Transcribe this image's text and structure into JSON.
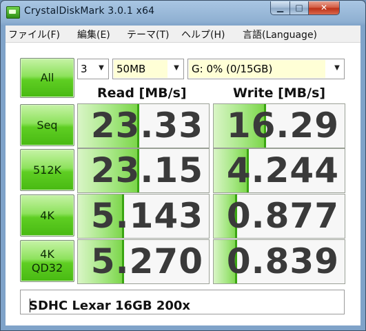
{
  "window": {
    "title": "CrystalDiskMark 3.0.1 x64"
  },
  "menu": [
    "ファイル(F)",
    "編集(E)",
    "テーマ(T)",
    "ヘルプ(H)",
    "言語(Language)"
  ],
  "controls": {
    "all_label": "All",
    "count_value": "3",
    "size_value": "50MB",
    "drive_value": "G: 0% (0/15GB)"
  },
  "headers": {
    "read": "Read [MB/s]",
    "write": "Write [MB/s]"
  },
  "tests": [
    {
      "label": "Seq",
      "read": "23.33",
      "write": "16.29",
      "read_fill": 0.47,
      "write_fill": 0.4
    },
    {
      "label": "512K",
      "read": "23.15",
      "write": "4.244",
      "read_fill": 0.47,
      "write_fill": 0.27
    },
    {
      "label": "4K",
      "read": "5.143",
      "write": "0.877",
      "read_fill": 0.35,
      "write_fill": 0.18
    },
    {
      "label": "4K\nQD32",
      "read": "5.270",
      "write": "0.839",
      "read_fill": 0.35,
      "write_fill": 0.18
    }
  ],
  "comment": "SDHC Lexar 16GB 200x"
}
